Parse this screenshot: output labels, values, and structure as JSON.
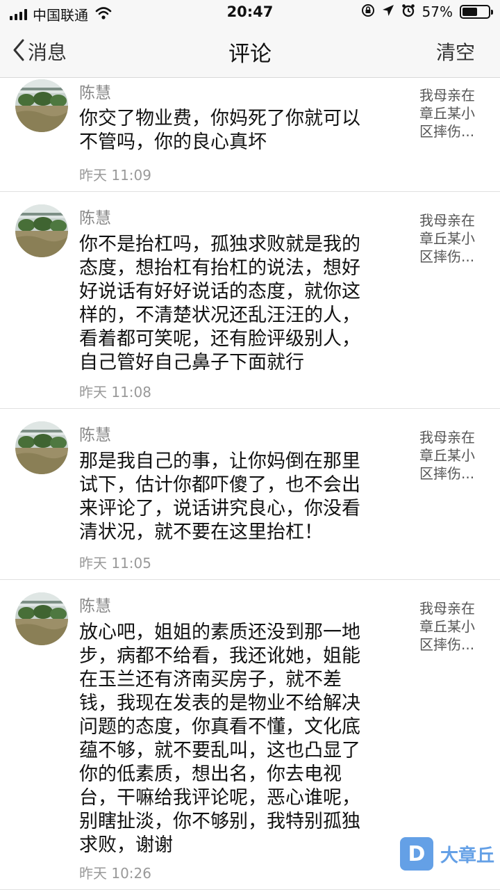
{
  "status_bar": {
    "carrier": "中国联通",
    "time": "20:47",
    "battery_pct": "57%",
    "battery_level": 0.57
  },
  "nav": {
    "back_label": "消息",
    "title": "评论",
    "clear_label": "清空"
  },
  "comments": [
    {
      "name": "陈慧",
      "lines": [
        "你交了物业费，你妈死了你就可以",
        "不管吗，你的良心真坏"
      ],
      "time": "昨天 11:09",
      "ref": [
        "我母亲在",
        "章丘某小",
        "区摔伤..."
      ]
    },
    {
      "name": "陈慧",
      "lines": [
        "你不是抬杠吗，孤独求败就是我的",
        "态度，想抬杠有抬杠的说法，想好",
        "好说话有好好说话的态度，就你这",
        "样的，不清楚状况还乱汪汪的人，",
        "看着都可笑呢，还有脸评级别人，",
        "自己管好自己鼻子下面就行"
      ],
      "time": "昨天 11:08",
      "ref": [
        "我母亲在",
        "章丘某小",
        "区摔伤..."
      ]
    },
    {
      "name": "陈慧",
      "lines": [
        "那是我自己的事，让你妈倒在那里",
        "试下，估计你都吓傻了，也不会出",
        "来评论了，说话讲究良心，你没看",
        "清状况，就不要在这里抬杠！"
      ],
      "time": "昨天 11:05",
      "ref": [
        "我母亲在",
        "章丘某小",
        "区摔伤..."
      ]
    },
    {
      "name": "陈慧",
      "lines": [
        "放心吧，姐姐的素质还没到那一地",
        "步，病都不给看，我还讹她，姐能",
        "在玉兰还有济南买房子，就不差",
        "钱，我现在发表的是物业不给解决",
        "问题的态度，你真看不懂，文化底",
        "蕴不够，就不要乱叫，这也凸显了",
        "你的低素质，想出名，你去电视",
        "台，干嘛给我评论呢，恶心谁呢，",
        "别瞎扯淡，你不够别，我特别孤独",
        "求败，谢谢"
      ],
      "time": "昨天 10:26",
      "ref": [
        "我母亲在",
        "章丘某小",
        "区摔伤..."
      ]
    }
  ],
  "watermark": {
    "logo_letter": "D",
    "text": "大章丘"
  }
}
